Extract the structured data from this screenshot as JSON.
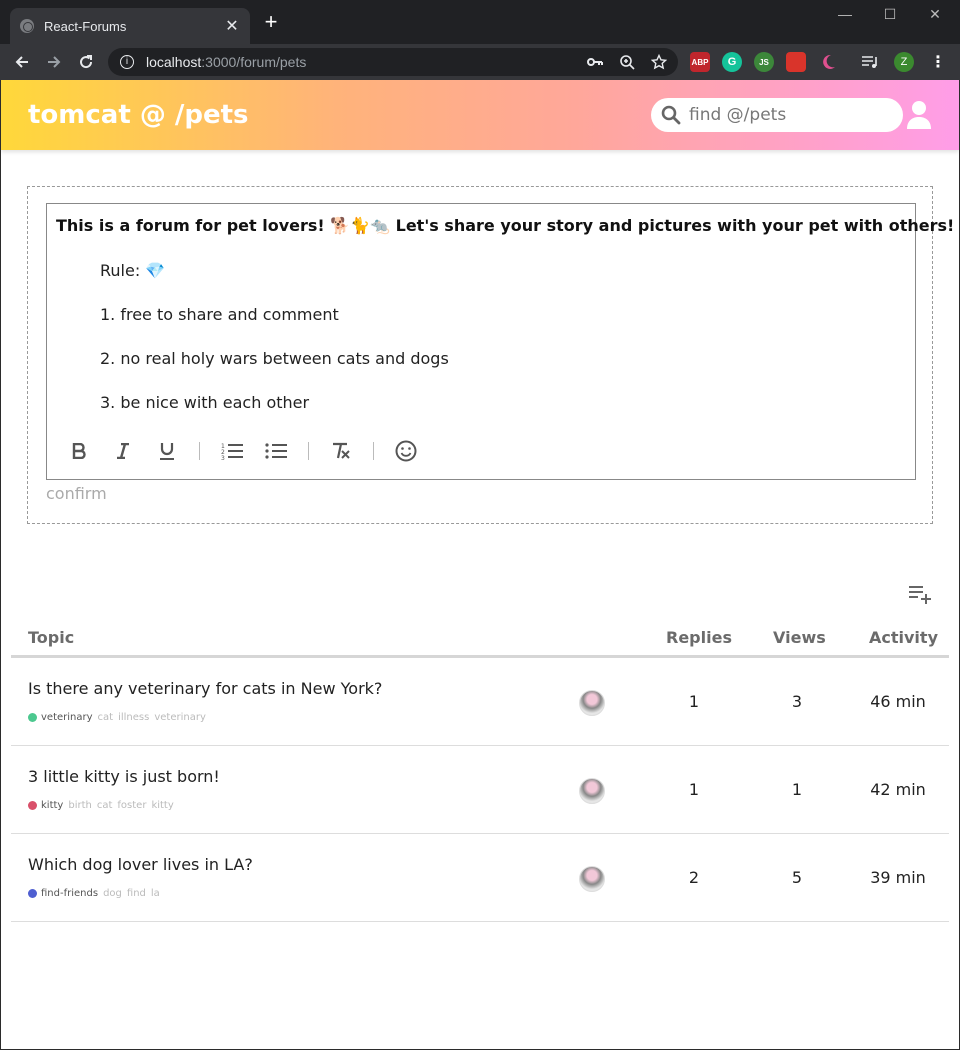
{
  "browser": {
    "tab_title": "React-Forums",
    "url_host": "localhost",
    "url_path": ":3000/forum/pets",
    "new_tab": "+",
    "tab_close": "✕",
    "extensions": [
      "ABP",
      "G",
      "JS"
    ],
    "profile_initial": "Z"
  },
  "header": {
    "brand": "tomcat @ /pets",
    "search_placeholder": "find @/pets"
  },
  "editor": {
    "title": "This is a forum for pet lovers! 🐕🐈🐀 Let's share your story and pictures with your pet with others!",
    "lines": [
      "Rule: 💎",
      "1. free to share and comment",
      "2. no real holy wars between cats and dogs",
      "3. be nice with each other"
    ],
    "tools": [
      "bold-icon",
      "italic-icon",
      "underline-icon",
      "ordered-list-icon",
      "unordered-list-icon",
      "clear-format-icon",
      "emoji-icon"
    ],
    "confirm_label": "confirm"
  },
  "table": {
    "columns": [
      "Topic",
      "Replies",
      "Views",
      "Activity"
    ],
    "rows": [
      {
        "title": "Is there any veterinary for cats in New York?",
        "category": "veterinary",
        "category_color": "#4cc88f",
        "tags": [
          "cat",
          "illness",
          "veterinary"
        ],
        "replies": "1",
        "views": "3",
        "activity": "46 min"
      },
      {
        "title": "3 little kitty is just born!",
        "category": "kitty",
        "category_color": "#d9506a",
        "tags": [
          "birth",
          "cat",
          "foster",
          "kitty"
        ],
        "replies": "1",
        "views": "1",
        "activity": "42 min"
      },
      {
        "title": "Which dog lover lives in LA?",
        "category": "find-friends",
        "category_color": "#4f5fd1",
        "tags": [
          "dog",
          "find",
          "la"
        ],
        "replies": "2",
        "views": "5",
        "activity": "39 min"
      }
    ]
  }
}
